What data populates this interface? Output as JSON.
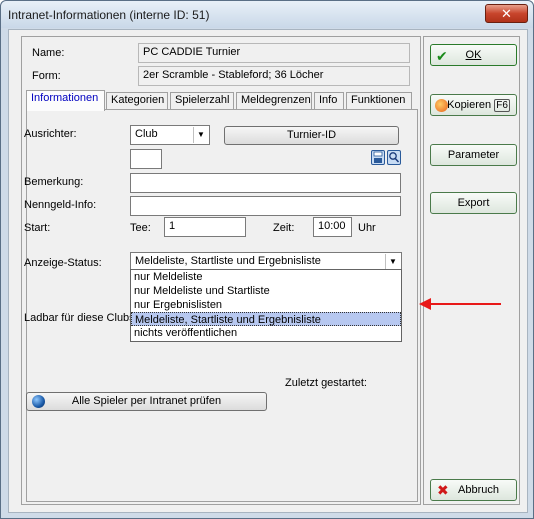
{
  "window": {
    "title": "Intranet-Informationen (interne ID: 51)",
    "close_glyph": "✕"
  },
  "header": {
    "name_label": "Name:",
    "name_value": "PC CADDIE Turnier",
    "form_label": "Form:",
    "form_value": "2er Scramble - Stableford; 36 Löcher"
  },
  "tabs": [
    {
      "label": "Informationen",
      "active": true
    },
    {
      "label": "Kategorien"
    },
    {
      "label": "Spielerzahl"
    },
    {
      "label": "Meldegrenzen"
    },
    {
      "label": "Info"
    },
    {
      "label": "Funktionen"
    }
  ],
  "info": {
    "ausrichter_label": "Ausrichter:",
    "ausrichter_value": "Club",
    "turnier_id_button": "Turnier-ID",
    "bemerkung_label": "Bemerkung:",
    "nenngeld_label": "Nenngeld-Info:",
    "start_label": "Start:",
    "tee_label": "Tee:",
    "tee_value": "1",
    "zeit_label": "Zeit:",
    "zeit_value": "10:00",
    "uhr_label": "Uhr",
    "anzeige_label": "Anzeige-Status:",
    "anzeige_value": "Meldeliste, Startliste und Ergebnisliste",
    "anzeige_options": [
      "nur Meldeliste",
      "nur Meldeliste und Startliste",
      "nur Ergebnislisten",
      "Meldeliste, Startliste und Ergebnisliste",
      "nichts veröffentlichen"
    ],
    "ladbar_label": "Ladbar für diese Clubs",
    "zuletzt_label": "Zuletzt gestartet:",
    "pruefen_button": "Alle Spieler per Intranet prüfen"
  },
  "buttons": {
    "ok": "OK",
    "kopieren": "Kopieren",
    "kopieren_key": "F6",
    "parameter": "Parameter",
    "export": "Export",
    "abbruch": "Abbruch"
  },
  "colors": {
    "annotation_arrow": "#e81818",
    "selected_option": "#b7c8f0",
    "active_tab_text": "#0000c0"
  }
}
